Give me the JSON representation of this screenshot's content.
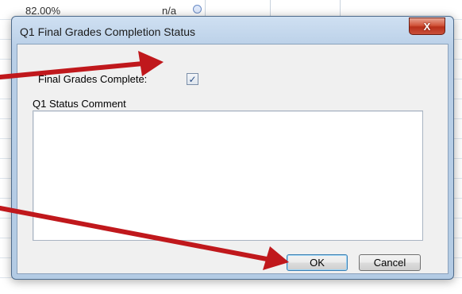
{
  "background": {
    "cell_value": "82.00%",
    "cell_na": "n/a"
  },
  "dialog": {
    "title": "Q1 Final Grades Completion Status",
    "close_label": "X",
    "final_grades_label": "Final Grades Complete:",
    "final_grades_checked": true,
    "status_comment_label": "Q1 Status Comment",
    "status_comment_value": "",
    "ok_label": "OK",
    "cancel_label": "Cancel"
  },
  "annotations": {
    "arrow_color": "#c0181c",
    "arrows": [
      "points-to-checkbox",
      "points-to-ok-button"
    ]
  }
}
